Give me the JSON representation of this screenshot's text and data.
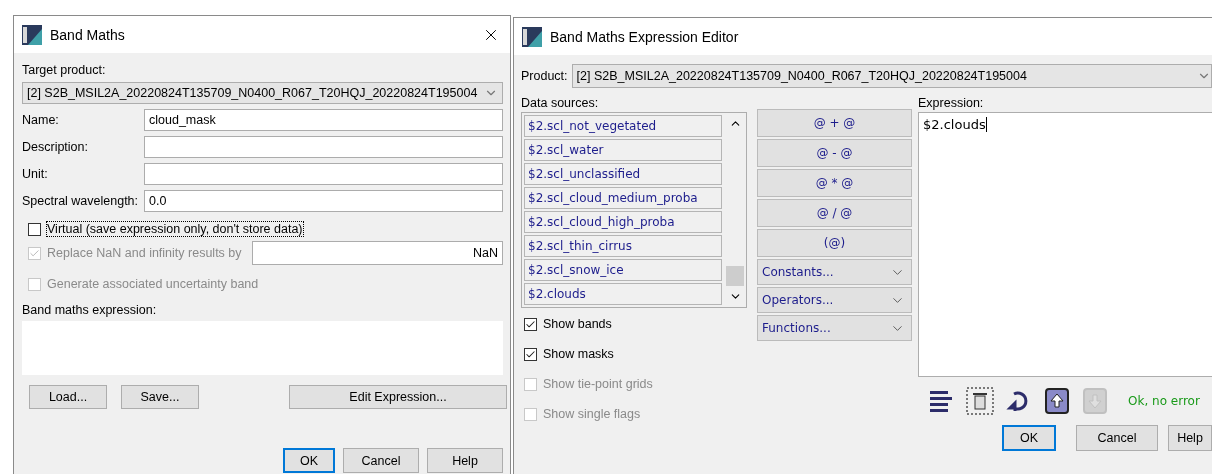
{
  "band_maths": {
    "title": "Band Maths",
    "target_product_label": "Target product:",
    "target_product": "[2] S2B_MSIL2A_20220824T135709_N0400_R067_T20HQJ_20220824T195004",
    "fields": [
      {
        "label": "Name:",
        "value": "cloud_mask"
      },
      {
        "label": "Description:"
      },
      {
        "label": "Unit:"
      },
      {
        "label": "Spectral wavelength:",
        "value": "0.0"
      }
    ],
    "options": [
      {
        "kind": "checkbox",
        "label": "Virtual (save expression only, don't store data)",
        "checked": false,
        "disabled": false,
        "focused": true
      },
      {
        "kind": "checkbox_field",
        "label": "Replace NaN and infinity results by",
        "checked": true,
        "disabled": true,
        "focused": false,
        "value": "NaN"
      },
      {
        "kind": "checkbox",
        "label": "Generate associated uncertainty band",
        "checked": false,
        "disabled": true,
        "focused": false
      }
    ],
    "expression_label": "Band maths expression:",
    "actions": [
      {
        "kind": "small",
        "label": "Load..."
      },
      {
        "kind": "small",
        "label": "Save..."
      },
      {
        "kind": "wide",
        "label": "Edit Expression..."
      }
    ],
    "footer": [
      {
        "label": "OK",
        "default": true
      },
      {
        "label": "Cancel",
        "default": false
      },
      {
        "label": "Help",
        "default": false
      }
    ]
  },
  "expression_editor": {
    "title": "Band Maths Expression Editor",
    "product_label": "Product:",
    "product": "[2] S2B_MSIL2A_20220824T135709_N0400_R067_T20HQJ_20220824T195004",
    "data_sources_label": "Data sources:",
    "data_sources": [
      "$2.scl_not_vegetated",
      "$2.scl_water",
      "$2.scl_unclassified",
      "$2.scl_cloud_medium_proba",
      "$2.scl_cloud_high_proba",
      "$2.scl_thin_cirrus",
      "$2.scl_snow_ice",
      "$2.clouds"
    ],
    "operators": [
      "@ + @",
      "@ - @",
      "@ * @",
      "@ / @",
      "(@)"
    ],
    "menus": [
      "Constants...",
      "Operators...",
      "Functions..."
    ],
    "options": [
      {
        "label": "Show bands",
        "checked": true,
        "disabled": false
      },
      {
        "label": "Show masks",
        "checked": true,
        "disabled": false
      },
      {
        "label": "Show tie-point grids",
        "checked": false,
        "disabled": true
      },
      {
        "label": "Show single flags",
        "checked": false,
        "disabled": true
      }
    ],
    "expression_label": "Expression:",
    "expression": "$2.clouds",
    "tools": [
      {
        "kind": "format",
        "disabled": false
      },
      {
        "kind": "clear",
        "disabled": false
      },
      {
        "kind": "undo",
        "disabled": false
      },
      {
        "kind": "load",
        "disabled": false
      },
      {
        "kind": "save",
        "disabled": true
      }
    ],
    "status": "Ok, no error",
    "footer": [
      {
        "label": "OK",
        "default": true
      },
      {
        "label": "Cancel",
        "default": false
      },
      {
        "label": "Help",
        "default": false
      }
    ]
  }
}
